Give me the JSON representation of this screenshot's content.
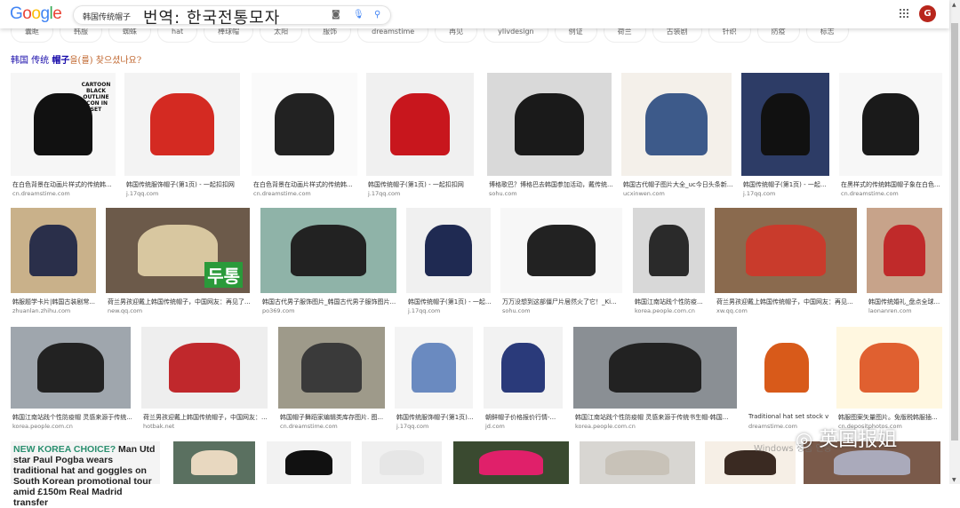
{
  "header": {
    "logo": "Google",
    "query": "韩国传统帽子",
    "translation_overlay": "번역: 한국전통모자",
    "camera_icon": "camera-icon",
    "mic_icon": "mic-icon",
    "search_icon": "search-icon",
    "avatar_letter": "G",
    "avatar_color": "#b8261c"
  },
  "chips": [
    "囊眶",
    "韩服",
    "蜘蛛",
    "hat",
    "棒球帽",
    "太阳",
    "服饰",
    "dreamstime",
    "再见",
    "ylivdesign",
    "例证",
    "荷兰",
    "古装剧",
    "针织",
    "防疫",
    "标志"
  ],
  "did_you_mean": {
    "query_plain": "韩国 传统 ",
    "query_bold": "帽子",
    "suffix": "을(를) 찾으셨나요?"
  },
  "results": [
    [
      {
        "caption": "在白色背景在动画片样式的传统韩...",
        "source": "cn.dreamstime.com"
      },
      {
        "caption": "韩国传统服饰帽子(第1页) - 一起扣扣网",
        "source": "j.17qq.com"
      },
      {
        "caption": "在白色背景在动画片样式的传统韩...",
        "source": "cn.dreamstime.com"
      },
      {
        "caption": "韩国传统帽子(第1页) - 一起扣扣网",
        "source": "j.17qq.com"
      },
      {
        "caption": "博格歌巴？博格巴去韩国参加活动，戴传统...",
        "source": "sohu.com"
      },
      {
        "caption": "韩国古代帽子图片大全_uc今日头条新...",
        "source": "ucxinwen.com"
      },
      {
        "caption": "韩国传统帽子(第1页) - 一起...",
        "source": "j.17qq.com"
      },
      {
        "caption": "在黑样式的传统韩国帽子象在白色...",
        "source": "cn.dreamstime.com"
      }
    ],
    [
      {
        "caption": "韩服题学卡片|韩国古装剧常...",
        "source": "zhuanlan.zhihu.com"
      },
      {
        "caption": "荷兰男孩迎戴上韩国传统帽子，中国网友：再见了...",
        "source": "new.qq.com"
      },
      {
        "caption": "韩国古代男子服饰图片_韩国古代男子服饰图片...",
        "source": "po369.com"
      },
      {
        "caption": "韩国传统帽子(第1页) - 一起...",
        "source": "j.17qq.com"
      },
      {
        "caption": "万万没想到这部僵尸片居然火了它！_Ki...",
        "source": "sohu.com"
      },
      {
        "caption": "韩国江南站践个性防疫...",
        "source": "korea.people.com.cn"
      },
      {
        "caption": "荷兰男孩迎戴上韩国传统帽子，中国网友：再见...",
        "source": "xw.qq.com"
      },
      {
        "caption": "韩国传统婚礼_盘点全球...",
        "source": "laonanren.com"
      }
    ],
    [
      {
        "caption": "韩国江南站践个性防疫帽 灵感来源于传统...",
        "source": "korea.people.com.cn"
      },
      {
        "caption": "荷兰男孩迎戴上韩国传统帽子，中国网友：...",
        "source": "hotbak.net"
      },
      {
        "caption": "韩国帽子舞蹈家编辑类库存图片. 图...",
        "source": "cn.dreamstime.com"
      },
      {
        "caption": "韩国传统服饰帽子(第1页)...",
        "source": "j.17qq.com"
      },
      {
        "caption": "朝鲜帽子价格报价行情-...",
        "source": "jd.com"
      },
      {
        "caption": "韩国江南站践个性防疫帽 灵感来源于传统书生帽-韩国...",
        "source": "korea.people.com.cn"
      },
      {
        "caption": "Traditional hat set stock v...",
        "source": "dreamstime.com"
      },
      {
        "caption": "韩服图案矢量图片。免版税韩服插...",
        "source": "cn.depositphotos.com"
      }
    ]
  ],
  "row4_news": {
    "highlight": "NEW KOREA CHOICE?",
    "text": " Man Utd star Paul Pogba wears traditional hat and goggles on South Korean promotional tour amid £150m Real Madrid transfer"
  },
  "image_overlay_texts": {
    "cartoon_label": "CARTOON BLACK OUTLINE ICON IN SET",
    "drama_text": "두통"
  },
  "watermark": "英国报姐",
  "windows_watermark": "Windows 정품 인증"
}
